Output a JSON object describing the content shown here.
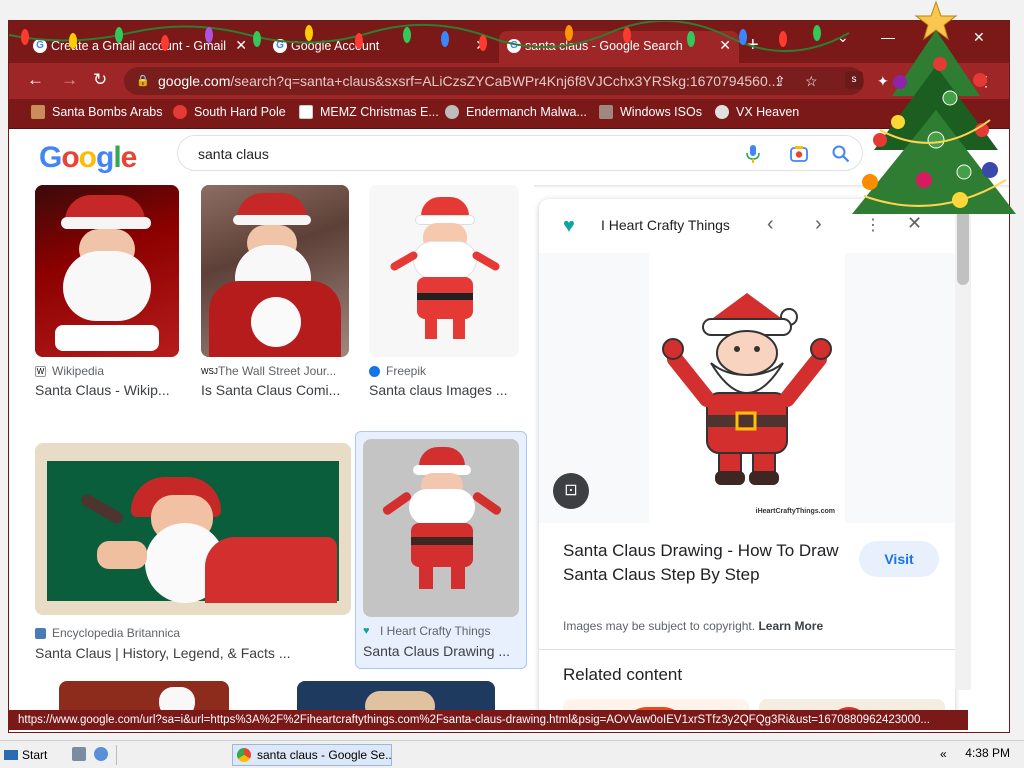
{
  "browser": {
    "tabs": [
      {
        "title": "Create a Gmail account - Gmail",
        "active": false
      },
      {
        "title": "Google Account",
        "active": false
      },
      {
        "title": "santa claus - Google Search",
        "active": true
      }
    ],
    "url_host": "google.com",
    "url_rest": "/search?q=santa+claus&sxsrf=ALiCzsZYCaBWPr4Knj6f8VJCchx3YRSkg:1670794560...",
    "bookmarks": [
      "Santa Bombs Arabs",
      "South Hard Pole",
      "MEMZ Christmas E...",
      "Endermanch Malwa...",
      "Windows ISOs",
      "VX Heaven"
    ],
    "status_url": "https://www.google.com/url?sa=i&url=https%3A%2F%2Fiheartcraftythings.com%2Fsanta-claus-drawing.html&psig=AOvVaw0oIEV1xrSTfz3y2QFQg3Ri&ust=1670880962423000..."
  },
  "google": {
    "logo": "Google",
    "query": "santa claus"
  },
  "results": [
    {
      "source": "Wikipedia",
      "title": "Santa Claus - Wikip..."
    },
    {
      "source": "The Wall Street Jour...",
      "title": "Is Santa Claus Comi..."
    },
    {
      "source": "Freepik",
      "title": "Santa claus Images ..."
    },
    {
      "source": "Encyclopedia Britannica",
      "title": "Santa Claus | History, Legend, & Facts ..."
    },
    {
      "source": "I Heart Crafty Things",
      "title": "Santa Claus Drawing ..."
    }
  ],
  "panel": {
    "site": "I Heart Crafty Things",
    "title": "Santa Claus Drawing - How To Draw Santa Claus Step By Step",
    "visit_label": "Visit",
    "copyright": "Images may be subject to copyright.",
    "learn_more": "Learn More",
    "related_heading": "Related content",
    "watermark": "iHeartCraftyThings.com"
  },
  "taskbar": {
    "start_label": "Start",
    "task_label": "santa claus - Google Se...",
    "clock": "4:38 PM"
  },
  "colors": {
    "chrome_dark": "#7b1818",
    "chrome_mid": "#9e2626",
    "google_blue": "#1a73e8",
    "visit_bg": "#e8f0fe"
  }
}
